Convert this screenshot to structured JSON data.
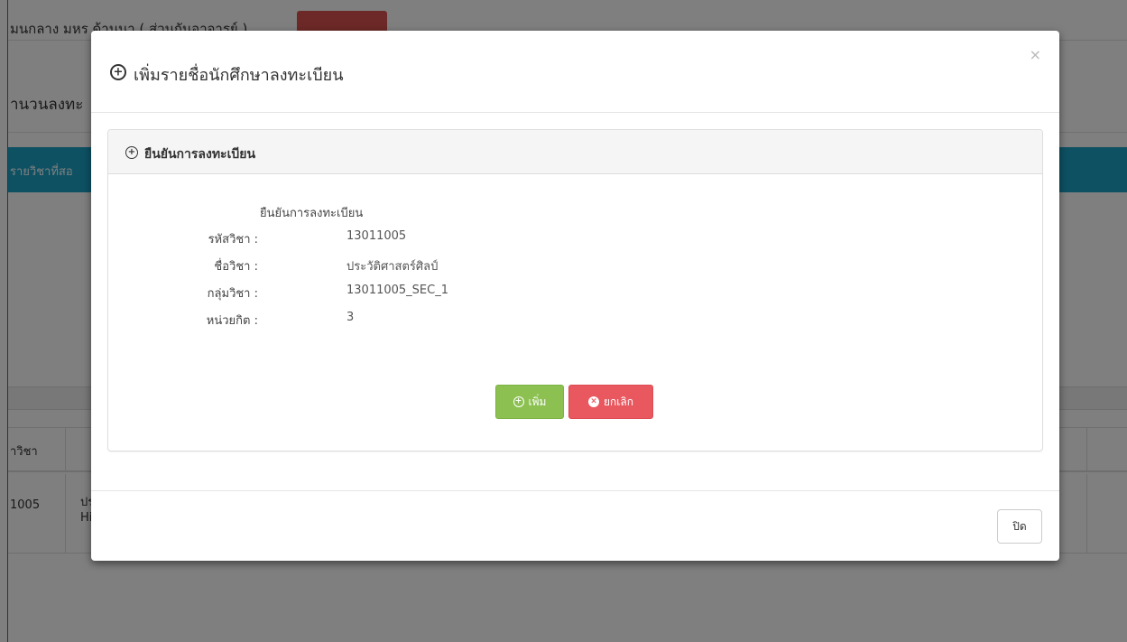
{
  "background": {
    "topbar_text": "มนกลาง มหร ด้านนา ( ส่วนกันอาจารย์ )",
    "heading": "านวนลงทะ",
    "teal_bar_text": "รายวิชาที่สอ",
    "table_header": "าวิชา",
    "row": {
      "code": "1005",
      "name_line1": "ปร",
      "name_line2": "Hi"
    }
  },
  "modal": {
    "title": "เพิ่มรายชื่อนักศึกษาลงทะเบียน",
    "close_symbol": "×",
    "panel": {
      "title": "ยืนยันการลงทะเบียน",
      "confirm_title": "ยืนยันการลงทะเบียน",
      "fields": [
        {
          "label": "รหัสวิชา :",
          "value": "13011005"
        },
        {
          "label": "ชื่อวิชา :",
          "value": "ประวัติศาสตร์ศิลป์"
        },
        {
          "label": "กลุ่มวิชา :",
          "value": "13011005_SEC_1"
        },
        {
          "label": "หน่วยกิต :",
          "value": "3"
        }
      ],
      "add_label": "เพิ่ม",
      "cancel_label": "ยกเลิก"
    },
    "footer_close_label": "ปิด"
  },
  "colors": {
    "add_button": "#8cc152",
    "cancel_button": "#e9575f",
    "teal_bar": "#1aa3c7",
    "red_button": "#d9534f"
  },
  "icons": {
    "title_icon": "plus-circle-icon",
    "panel_icon": "plus-circle-icon",
    "add_icon": "plus-circle-icon",
    "cancel_icon": "times-circle-icon"
  }
}
